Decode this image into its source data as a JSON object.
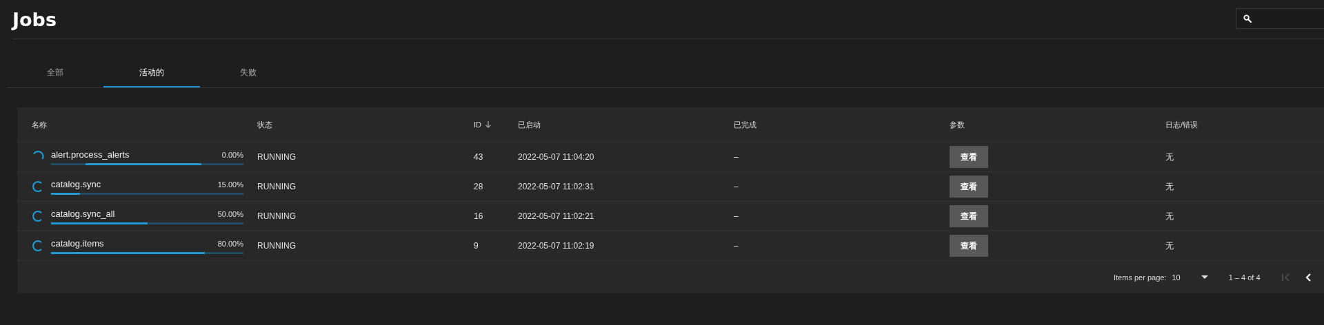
{
  "page": {
    "title": "Jobs"
  },
  "tabs": [
    {
      "label": "全部",
      "selected": false
    },
    {
      "label": "活动的",
      "selected": true
    },
    {
      "label": "失败",
      "selected": false
    }
  ],
  "table": {
    "columns": [
      {
        "label": "名称",
        "sorted": false
      },
      {
        "label": "状态",
        "sorted": false
      },
      {
        "label": "ID",
        "sorted": true
      },
      {
        "label": "已启动",
        "sorted": false
      },
      {
        "label": "已完成",
        "sorted": false
      },
      {
        "label": "参数",
        "sorted": false
      },
      {
        "label": "日志/错误",
        "sorted": false
      }
    ],
    "rows": [
      {
        "name": "alert.process_alerts",
        "percent": "0.00%",
        "indeterminate": true,
        "state": "RUNNING",
        "id": "43",
        "started": "2022-05-07 11:04:20",
        "finished": "–",
        "args_button": "查看",
        "logs": "无"
      },
      {
        "name": "catalog.sync",
        "percent": "15.00%",
        "level": 0.15,
        "indeterminate": false,
        "state": "RUNNING",
        "id": "28",
        "started": "2022-05-07 11:02:31",
        "finished": "–",
        "args_button": "查看",
        "logs": "无"
      },
      {
        "name": "catalog.sync_all",
        "percent": "50.00%",
        "level": 0.5,
        "indeterminate": false,
        "state": "RUNNING",
        "id": "16",
        "started": "2022-05-07 11:02:21",
        "finished": "–",
        "args_button": "查看",
        "logs": "无"
      },
      {
        "name": "catalog.items",
        "percent": "80.00%",
        "level": 0.8,
        "indeterminate": false,
        "state": "RUNNING",
        "id": "9",
        "started": "2022-05-07 11:02:19",
        "finished": "–",
        "args_button": "查看",
        "logs": "无"
      }
    ]
  },
  "paginator": {
    "label": "Items per page:",
    "page_size": "10",
    "range": "1 – 4 of 4",
    "first_disabled": true,
    "prev_disabled": false
  }
}
